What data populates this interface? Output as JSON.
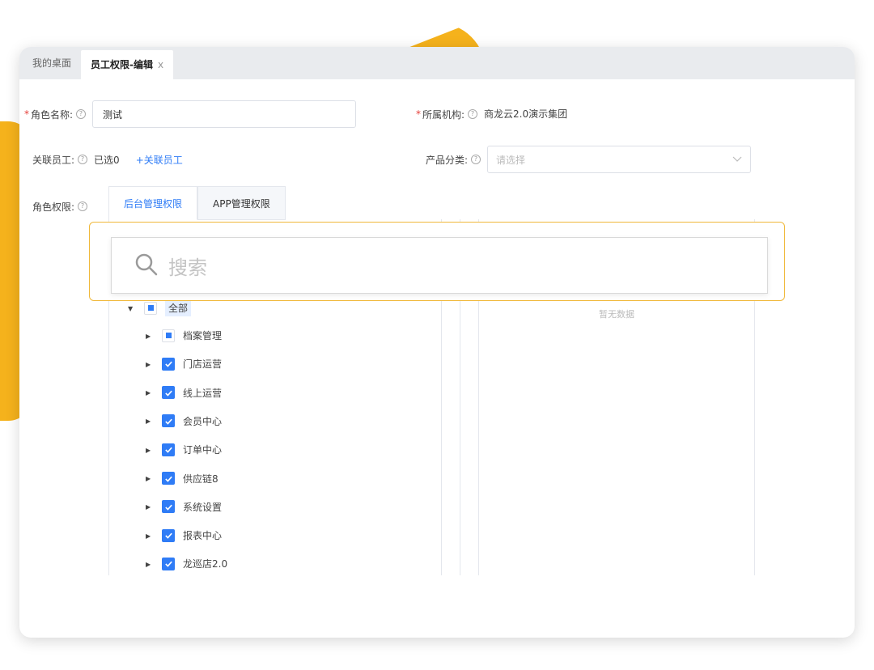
{
  "tabs": [
    {
      "label": "我的桌面"
    },
    {
      "label": "员工权限-编辑",
      "close": "x"
    }
  ],
  "form": {
    "role_name_label": "角色名称:",
    "role_name_value": "测试",
    "org_label": "所属机构:",
    "org_value": "商龙云2.0演示集团",
    "staff_label": "关联员工:",
    "staff_selected": "已选0",
    "staff_link": "+关联员工",
    "category_label": "产品分类:",
    "category_placeholder": "请选择",
    "permission_label": "角色权限:"
  },
  "permission_tabs": [
    {
      "label": "后台管理权限"
    },
    {
      "label": "APP管理权限"
    }
  ],
  "search": {
    "placeholder": "搜索"
  },
  "empty_text": "暂无数据",
  "tree": {
    "root": "全部",
    "items": [
      {
        "label": "档案管理",
        "state": "partial"
      },
      {
        "label": "门店运营",
        "state": "checked"
      },
      {
        "label": "线上运营",
        "state": "checked"
      },
      {
        "label": "会员中心",
        "state": "checked"
      },
      {
        "label": "订单中心",
        "state": "checked"
      },
      {
        "label": "供应链8",
        "state": "checked"
      },
      {
        "label": "系统设置",
        "state": "checked"
      },
      {
        "label": "报表中心",
        "state": "checked"
      },
      {
        "label": "龙巡店2.0",
        "state": "checked"
      }
    ]
  },
  "colors": {
    "accent": "#2f7cf6",
    "highlight": "#f5b21c"
  }
}
